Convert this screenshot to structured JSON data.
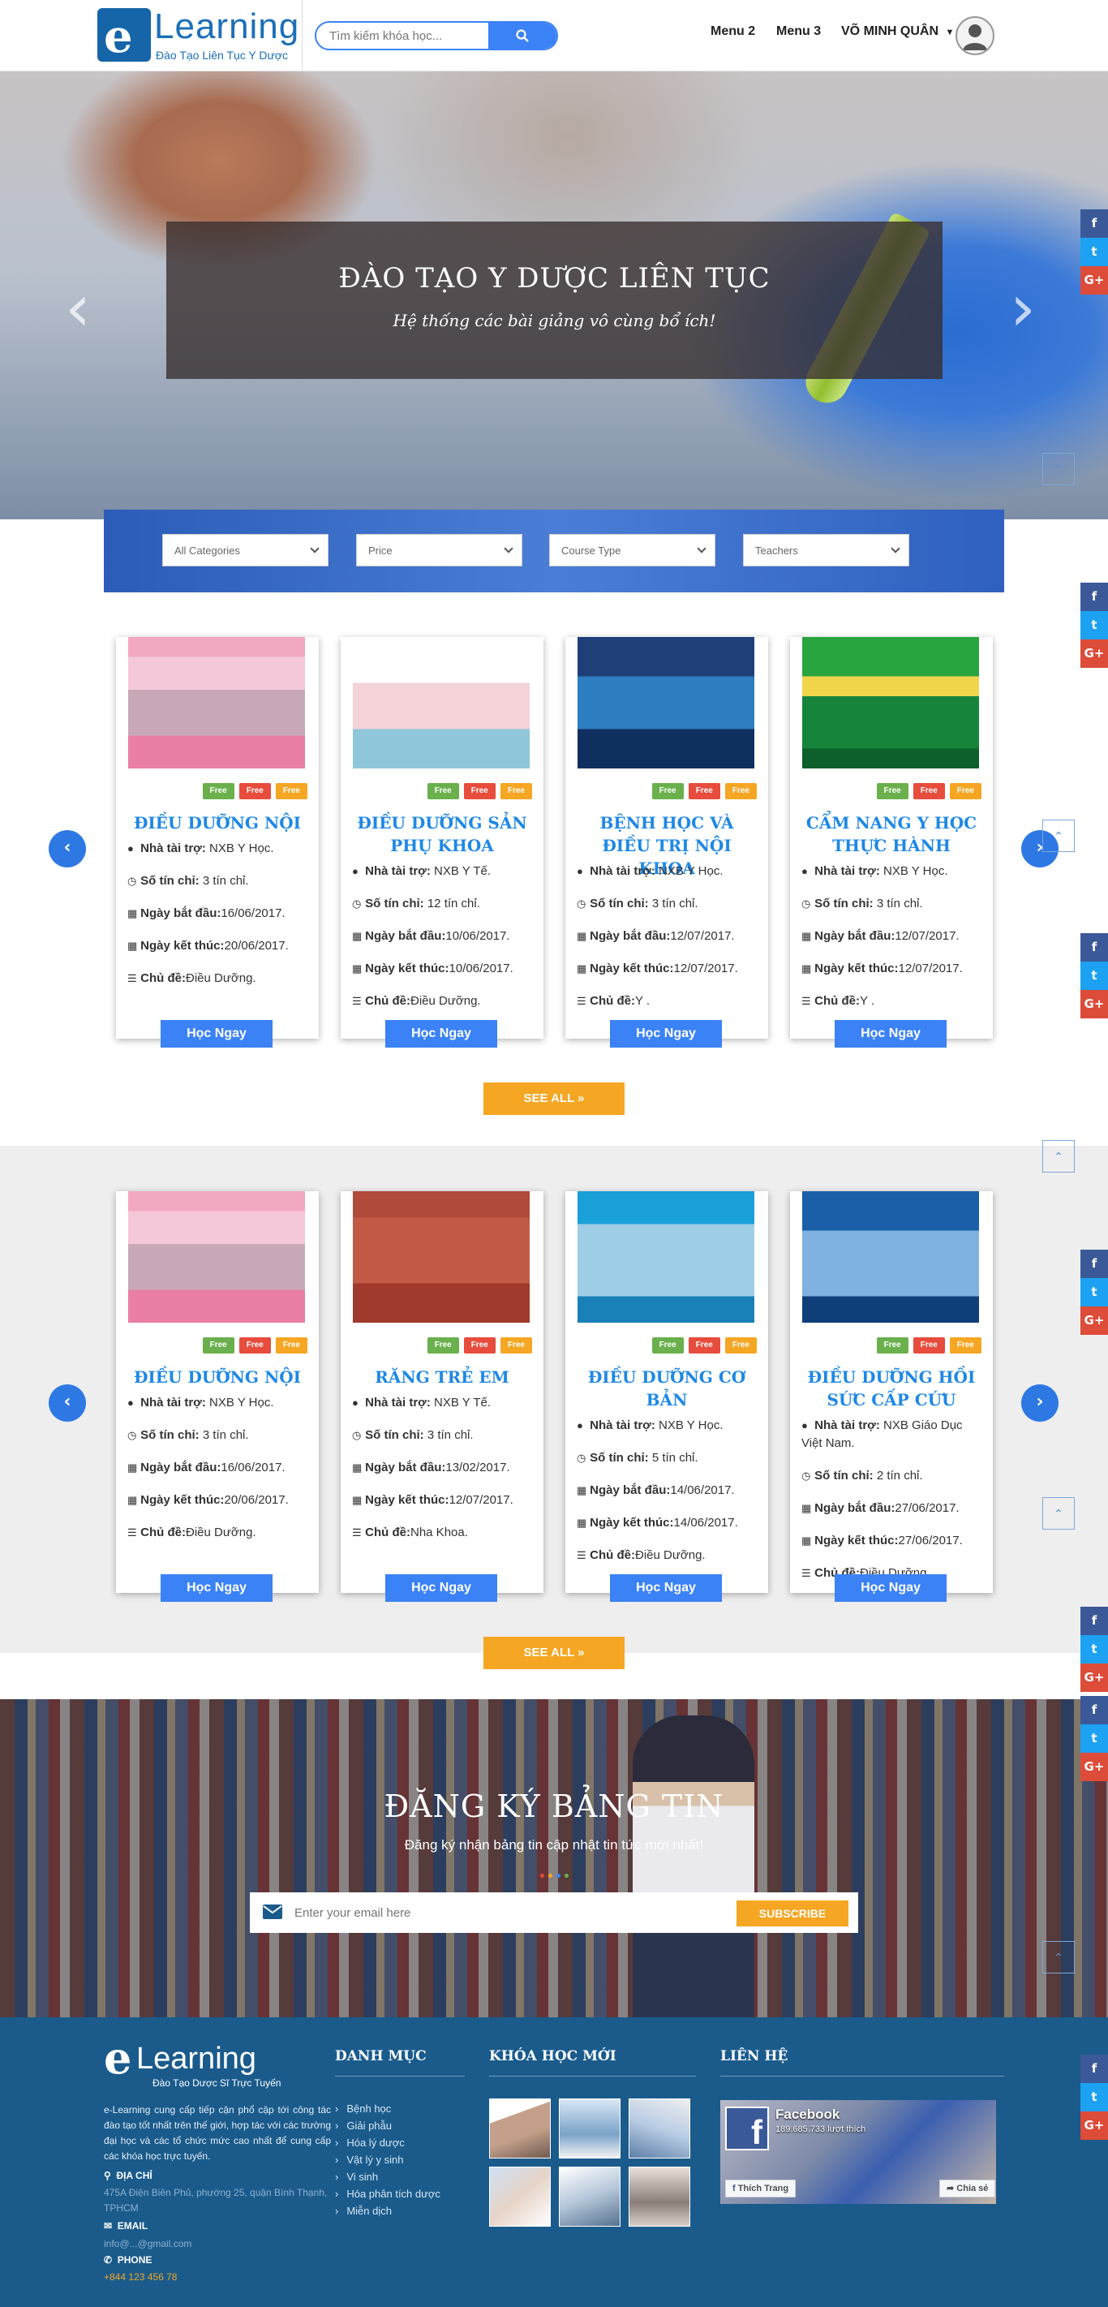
{
  "header": {
    "logo_text": "Learning",
    "logo_mark": "e",
    "logo_sub": "Đào Tạo Liên Tục Y Dược",
    "search_placeholder": "Tìm kiếm khóa học...",
    "menu2": "Menu 2",
    "menu3": "Menu 3",
    "user_name": "VÕ MINH QUÂN"
  },
  "hero": {
    "title": "ĐÀO TẠO Y DƯỢC LIÊN TỤC",
    "subtitle": "Hệ thống các bài giảng vô cùng bổ ích!"
  },
  "filters": [
    "All Categories",
    "Price",
    "Course Type",
    "Teachers"
  ],
  "labels": {
    "sponsor": "Nhà tài trợ:",
    "credits": "Số tín chỉ:",
    "start": "Ngày bắt đầu:",
    "end": "Ngày kết thúc:",
    "topic": "Chủ đề:",
    "free": "Free",
    "learn_now": "Học Ngay",
    "see_all": "SEE ALL »"
  },
  "courses1": [
    {
      "title": "ĐIỀU DƯỠNG NỘI",
      "sponsor": "NXB Y Học.",
      "credits": "3 tín chỉ.",
      "start": "16/06/2017.",
      "end": "20/06/2017.",
      "topic": "Điều Dưỡng."
    },
    {
      "title": "ĐIỀU DƯỠNG SẢN PHỤ KHOA",
      "sponsor": "NXB Y Tế.",
      "credits": "12 tín chỉ.",
      "start": "10/06/2017.",
      "end": "10/06/2017.",
      "topic": "Điều Dưỡng."
    },
    {
      "title": "BỆNH HỌC VÀ ĐIỀU TRỊ NỘI KHOA",
      "sponsor": "NXB Y Học.",
      "credits": "3 tín chỉ.",
      "start": "12/07/2017.",
      "end": "12/07/2017.",
      "topic": "Y ."
    },
    {
      "title": "CẨM NANG Y HỌC THỰC HÀNH",
      "sponsor": "NXB Y Học.",
      "credits": "3 tín chỉ.",
      "start": "12/07/2017.",
      "end": "12/07/2017.",
      "topic": "Y ."
    }
  ],
  "courses2": [
    {
      "title": "ĐIỀU DƯỠNG NỘI",
      "sponsor": "NXB Y Học.",
      "credits": "3 tín chỉ.",
      "start": "16/06/2017.",
      "end": "20/06/2017.",
      "topic": "Điều Dưỡng."
    },
    {
      "title": "RĂNG TRẺ EM",
      "sponsor": "NXB Y Tế.",
      "credits": "3 tín chỉ.",
      "start": "13/02/2017.",
      "end": "12/07/2017.",
      "topic": "Nha Khoa."
    },
    {
      "title": "ĐIỀU DƯỠNG CƠ BẢN",
      "sponsor": "NXB Y Học.",
      "credits": "5 tín chỉ.",
      "start": "14/06/2017.",
      "end": "14/06/2017.",
      "topic": "Điều Dưỡng."
    },
    {
      "title": "ĐIỀU DƯỠNG HỒI SỨC CẤP CỨU",
      "sponsor": "NXB Giáo Dục Việt Nam.",
      "credits": "2 tín chỉ.",
      "start": "27/06/2017.",
      "end": "27/06/2017.",
      "topic": "Điều Dưỡng."
    }
  ],
  "newsletter": {
    "title": "ĐĂNG KÝ BẢNG TIN",
    "subtitle": "Đăng ký nhận bảng tin cập nhật tin tức mới nhất!",
    "placeholder": "Enter your email here",
    "button": "SUBSCRIBE"
  },
  "footer": {
    "logo_text": "Learning",
    "logo_mark": "e",
    "logo_sub": "Đào Tạo Dược Sĩ Trực Tuyến",
    "about": "e-Learning cung cấp tiếp cận phổ cập tới công tác đào tạo tốt nhất trên thế giới, hợp tác với các trường đại học và các tổ chức mức cao nhất để cung cấp các khóa học trực tuyến.",
    "address_label": "ĐỊA CHỈ",
    "address": "475A Điện Biên Phủ, phường 25, quận Bình Thạnh, TPHCM",
    "email_label": "EMAIL",
    "email": "info@...@gmail.com",
    "phone_label": "PHONE",
    "phone": "+844 123 456 78",
    "col_categories": "DANH MỤC",
    "categories": [
      "Bệnh học",
      "Giải phẫu",
      "Hóa lý dược",
      "Vật lý y sinh",
      "Vi sinh",
      "Hóa phân tích dược",
      "Miễn dịch"
    ],
    "col_new_courses": "KHÓA HỌC MỚI",
    "col_contact": "LIÊN HỆ",
    "fb_name": "Facebook",
    "fb_likes": "189.685.733 lượt thích",
    "fb_like_btn": "Thích Trang",
    "fb_share_btn": "Chia sẻ"
  },
  "colors": {
    "primary": "#3b82f6",
    "accent": "#f5a623",
    "footer": "#1a5b8c",
    "title_blue": "#1e88e5"
  }
}
